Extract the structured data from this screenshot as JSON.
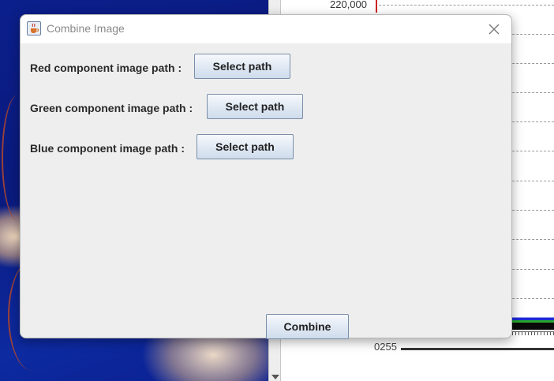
{
  "dialog": {
    "title": "Combine Image",
    "rows": [
      {
        "label": "Red component image path :",
        "button": "Select path"
      },
      {
        "label": "Green component image path :",
        "button": "Select path"
      },
      {
        "label": "Blue component image path :",
        "button": "Select path"
      }
    ],
    "combine_button": "Combine"
  },
  "background": {
    "histogram_tick": "220,000",
    "histogram_x_label": "0255"
  },
  "icons": {
    "window_icon": "java-cup-icon",
    "close": "close-icon"
  }
}
